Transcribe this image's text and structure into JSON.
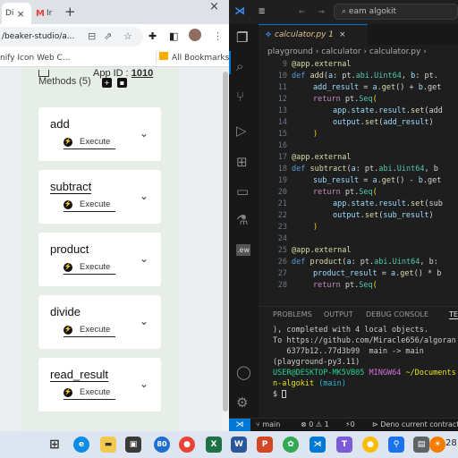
{
  "browser": {
    "tabs": [
      {
        "label": "Di",
        "close": "×"
      },
      {
        "label": "M",
        "suffix": "Ir",
        "close": ""
      }
    ],
    "new_tab": "+",
    "window_close": "×",
    "url": "/beaker-studio/a...",
    "bookmarks_left": "nify Icon Web C...",
    "bookmarks_all": "All Bookmarks"
  },
  "app": {
    "methods_label": "Methods (5)",
    "app_id_label": "App ID : ",
    "app_id_value": "1010",
    "methods": [
      {
        "name": "add",
        "execute": "Execute"
      },
      {
        "name": "subtract",
        "execute": "Execute"
      },
      {
        "name": "product",
        "execute": "Execute"
      },
      {
        "name": "divide",
        "execute": "Execute"
      },
      {
        "name": "read_result",
        "execute": "Execute"
      }
    ]
  },
  "vscode": {
    "search_text": "eam algokit",
    "tab_file": "calculator.py 1",
    "breadcrumb": "playground › calculator › calculator.py ›",
    "panel_tabs": [
      "PROBLEMS",
      "OUTPUT",
      "DEBUG CONSOLE",
      "TE"
    ],
    "terminal": {
      "line1": "), completed with 4 local objects.",
      "line2": "To https://github.com/Miracle656/algoran",
      "line3": "   6377b12..77d3b99  main -> main",
      "line4": "(playground-py3.11)",
      "prompt_user": "USER@DESKTOP-MK5VB05",
      "prompt_shell": "MINGW64",
      "prompt_path": "~/Documents",
      "prompt_line2": "n-algokit",
      "prompt_branch": "(main)",
      "prompt_symbol": "$"
    },
    "status": {
      "branch": "main",
      "errors": "⊗ 0 ⚠ 1",
      "ports": "⚡0",
      "task": "Deno current contract"
    }
  },
  "taskbar": {
    "badge": "80",
    "time": "28"
  }
}
